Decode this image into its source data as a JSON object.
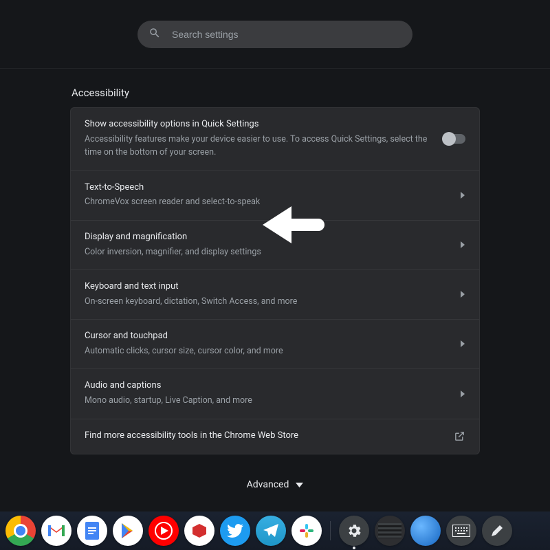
{
  "search": {
    "placeholder": "Search settings"
  },
  "page_title": "Accessibility",
  "rows": [
    {
      "title": "Show accessibility options in Quick Settings",
      "subtitle": "Accessibility features make your device easier to use. To access Quick Settings, select the time on the bottom of your screen.",
      "control": "toggle",
      "toggle_state": "off"
    },
    {
      "title": "Text-to-Speech",
      "subtitle": "ChromeVox screen reader and select-to-speak",
      "control": "drill"
    },
    {
      "title": "Display and magnification",
      "subtitle": "Color inversion, magnifier, and display settings",
      "control": "drill"
    },
    {
      "title": "Keyboard and text input",
      "subtitle": "On-screen keyboard, dictation, Switch Access, and more",
      "control": "drill"
    },
    {
      "title": "Cursor and touchpad",
      "subtitle": "Automatic clicks, cursor size, cursor color, and more",
      "control": "drill"
    },
    {
      "title": "Audio and captions",
      "subtitle": "Mono audio, startup, Live Caption, and more",
      "control": "drill"
    },
    {
      "title": "Find more accessibility tools in the Chrome Web Store",
      "subtitle": "",
      "control": "external"
    }
  ],
  "advanced_label": "Advanced",
  "shelf_apps": [
    "chrome",
    "gmail",
    "docs",
    "play",
    "youtube-music",
    "ruby",
    "twitter",
    "telegram",
    "slack",
    "settings",
    "flag",
    "globe",
    "keyboard",
    "pen"
  ]
}
